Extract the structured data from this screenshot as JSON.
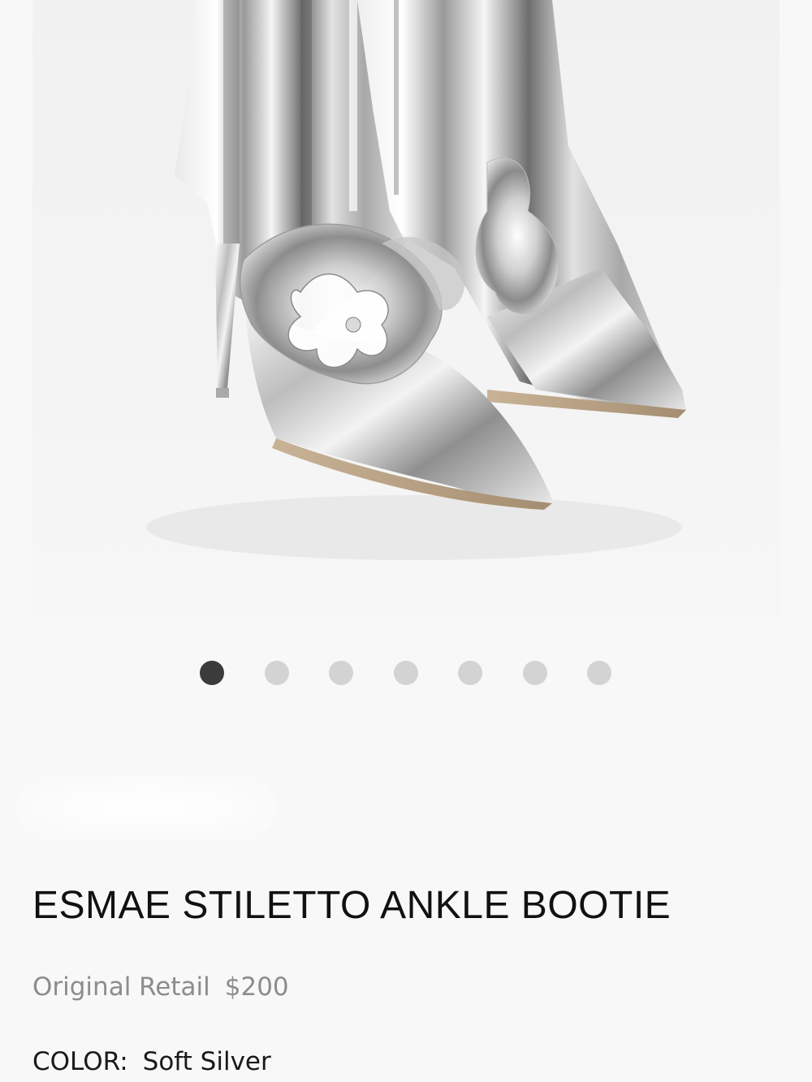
{
  "product": {
    "image_alt": "silver-metallic-ankle-booties-icon",
    "title": "ESMAE STILETTO ANKLE BOOTIE",
    "retail_label": "Original Retail",
    "retail_price": "$200",
    "color_label": "COLOR:",
    "color_value": "Soft Silver"
  },
  "carousel": {
    "count": 7,
    "active_index": 0,
    "active_color": "#3b3b3b",
    "inactive_color": "#d3d3d3"
  }
}
